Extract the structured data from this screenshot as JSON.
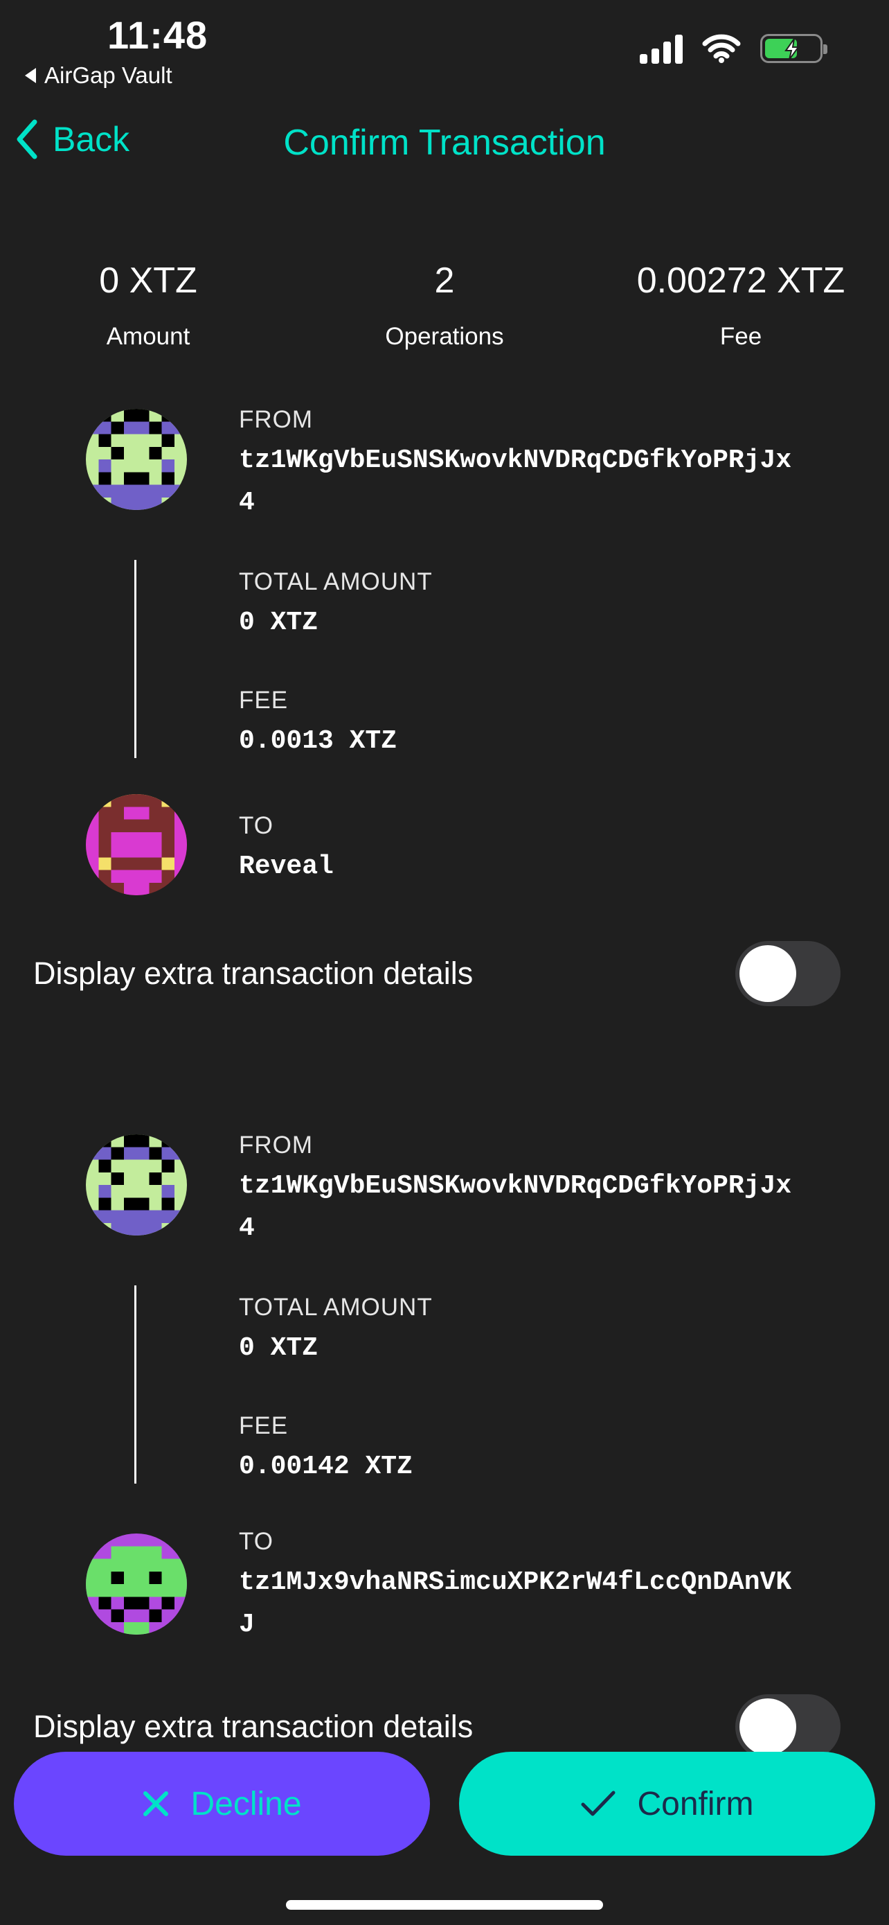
{
  "status_bar": {
    "time": "11:48",
    "back_app": "AirGap Vault",
    "signal_icon": "cellular-signal-icon",
    "wifi_icon": "wifi-icon",
    "battery_icon": "battery-charging-icon"
  },
  "nav": {
    "back_label": "Back",
    "title": "Confirm Transaction"
  },
  "summary": [
    {
      "value": "0 XTZ",
      "label": "Amount"
    },
    {
      "value": "2",
      "label": "Operations"
    },
    {
      "value": "0.00272 XTZ",
      "label": "Fee"
    }
  ],
  "operations": [
    {
      "from_label": "FROM",
      "from_address_line1": "tz1WKgVbEuSNSKwovkNVDRqCDGfkYoPRjJx",
      "from_address_line2": "4",
      "total_amount_label": "TOTAL AMOUNT",
      "total_amount": "0 XTZ",
      "fee_label": "FEE",
      "fee": "0.0013 XTZ",
      "to_label": "TO",
      "to_line1": "Reveal",
      "to_line2": "",
      "toggle_label": "Display extra transaction details",
      "toggle_on": false
    },
    {
      "from_label": "FROM",
      "from_address_line1": "tz1WKgVbEuSNSKwovkNVDRqCDGfkYoPRjJx",
      "from_address_line2": "4",
      "total_amount_label": "TOTAL AMOUNT",
      "total_amount": "0 XTZ",
      "fee_label": "FEE",
      "fee": "0.00142 XTZ",
      "to_label": "TO",
      "to_line1": "tz1MJx9vhaNRSimcuXPK2rW4fLccQnDAnVK",
      "to_line2": "J",
      "toggle_label": "Display extra transaction details",
      "toggle_on": false
    }
  ],
  "actions": {
    "decline_label": "Decline",
    "confirm_label": "Confirm"
  },
  "colors": {
    "accent": "#00e2c8",
    "decline_bg": "#6b46ff",
    "background": "#1f1f1f"
  }
}
